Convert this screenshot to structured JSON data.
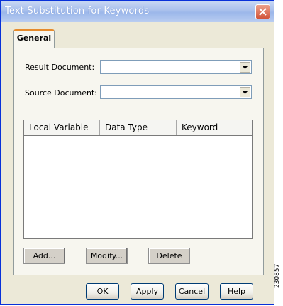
{
  "window": {
    "title": "Text Substitution for Keywords"
  },
  "tabs": [
    {
      "label": "General"
    }
  ],
  "form": {
    "result_document": {
      "label": "Result Document:",
      "value": ""
    },
    "source_document": {
      "label": "Source Document:",
      "value": ""
    }
  },
  "table": {
    "columns": [
      "Local Variable",
      "Data Type",
      "Keyword"
    ],
    "rows": []
  },
  "panel_buttons": {
    "add": "Add...",
    "modify": "Modify...",
    "delete": "Delete"
  },
  "dialog_buttons": {
    "ok": "OK",
    "apply": "Apply",
    "cancel": "Cancel",
    "help": "Help"
  },
  "figure_id": "230857",
  "colors": {
    "title_bar": "#9cb7ea",
    "close_button": "#d2543a",
    "dialog_bg": "#ece9d8",
    "tab_accent": "#e68b2c"
  }
}
